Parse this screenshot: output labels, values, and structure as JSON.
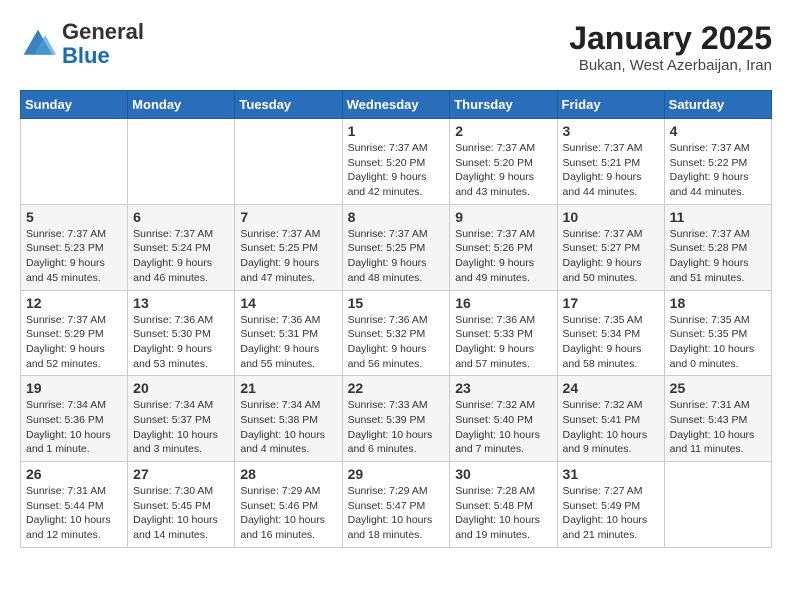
{
  "header": {
    "logo_line1": "General",
    "logo_line2": "Blue",
    "month": "January 2025",
    "location": "Bukan, West Azerbaijan, Iran"
  },
  "weekdays": [
    "Sunday",
    "Monday",
    "Tuesday",
    "Wednesday",
    "Thursday",
    "Friday",
    "Saturday"
  ],
  "weeks": [
    [
      {
        "day": "",
        "info": ""
      },
      {
        "day": "",
        "info": ""
      },
      {
        "day": "",
        "info": ""
      },
      {
        "day": "1",
        "info": "Sunrise: 7:37 AM\nSunset: 5:20 PM\nDaylight: 9 hours\nand 42 minutes."
      },
      {
        "day": "2",
        "info": "Sunrise: 7:37 AM\nSunset: 5:20 PM\nDaylight: 9 hours\nand 43 minutes."
      },
      {
        "day": "3",
        "info": "Sunrise: 7:37 AM\nSunset: 5:21 PM\nDaylight: 9 hours\nand 44 minutes."
      },
      {
        "day": "4",
        "info": "Sunrise: 7:37 AM\nSunset: 5:22 PM\nDaylight: 9 hours\nand 44 minutes."
      }
    ],
    [
      {
        "day": "5",
        "info": "Sunrise: 7:37 AM\nSunset: 5:23 PM\nDaylight: 9 hours\nand 45 minutes."
      },
      {
        "day": "6",
        "info": "Sunrise: 7:37 AM\nSunset: 5:24 PM\nDaylight: 9 hours\nand 46 minutes."
      },
      {
        "day": "7",
        "info": "Sunrise: 7:37 AM\nSunset: 5:25 PM\nDaylight: 9 hours\nand 47 minutes."
      },
      {
        "day": "8",
        "info": "Sunrise: 7:37 AM\nSunset: 5:25 PM\nDaylight: 9 hours\nand 48 minutes."
      },
      {
        "day": "9",
        "info": "Sunrise: 7:37 AM\nSunset: 5:26 PM\nDaylight: 9 hours\nand 49 minutes."
      },
      {
        "day": "10",
        "info": "Sunrise: 7:37 AM\nSunset: 5:27 PM\nDaylight: 9 hours\nand 50 minutes."
      },
      {
        "day": "11",
        "info": "Sunrise: 7:37 AM\nSunset: 5:28 PM\nDaylight: 9 hours\nand 51 minutes."
      }
    ],
    [
      {
        "day": "12",
        "info": "Sunrise: 7:37 AM\nSunset: 5:29 PM\nDaylight: 9 hours\nand 52 minutes."
      },
      {
        "day": "13",
        "info": "Sunrise: 7:36 AM\nSunset: 5:30 PM\nDaylight: 9 hours\nand 53 minutes."
      },
      {
        "day": "14",
        "info": "Sunrise: 7:36 AM\nSunset: 5:31 PM\nDaylight: 9 hours\nand 55 minutes."
      },
      {
        "day": "15",
        "info": "Sunrise: 7:36 AM\nSunset: 5:32 PM\nDaylight: 9 hours\nand 56 minutes."
      },
      {
        "day": "16",
        "info": "Sunrise: 7:36 AM\nSunset: 5:33 PM\nDaylight: 9 hours\nand 57 minutes."
      },
      {
        "day": "17",
        "info": "Sunrise: 7:35 AM\nSunset: 5:34 PM\nDaylight: 9 hours\nand 58 minutes."
      },
      {
        "day": "18",
        "info": "Sunrise: 7:35 AM\nSunset: 5:35 PM\nDaylight: 10 hours\nand 0 minutes."
      }
    ],
    [
      {
        "day": "19",
        "info": "Sunrise: 7:34 AM\nSunset: 5:36 PM\nDaylight: 10 hours\nand 1 minute."
      },
      {
        "day": "20",
        "info": "Sunrise: 7:34 AM\nSunset: 5:37 PM\nDaylight: 10 hours\nand 3 minutes."
      },
      {
        "day": "21",
        "info": "Sunrise: 7:34 AM\nSunset: 5:38 PM\nDaylight: 10 hours\nand 4 minutes."
      },
      {
        "day": "22",
        "info": "Sunrise: 7:33 AM\nSunset: 5:39 PM\nDaylight: 10 hours\nand 6 minutes."
      },
      {
        "day": "23",
        "info": "Sunrise: 7:32 AM\nSunset: 5:40 PM\nDaylight: 10 hours\nand 7 minutes."
      },
      {
        "day": "24",
        "info": "Sunrise: 7:32 AM\nSunset: 5:41 PM\nDaylight: 10 hours\nand 9 minutes."
      },
      {
        "day": "25",
        "info": "Sunrise: 7:31 AM\nSunset: 5:43 PM\nDaylight: 10 hours\nand 11 minutes."
      }
    ],
    [
      {
        "day": "26",
        "info": "Sunrise: 7:31 AM\nSunset: 5:44 PM\nDaylight: 10 hours\nand 12 minutes."
      },
      {
        "day": "27",
        "info": "Sunrise: 7:30 AM\nSunset: 5:45 PM\nDaylight: 10 hours\nand 14 minutes."
      },
      {
        "day": "28",
        "info": "Sunrise: 7:29 AM\nSunset: 5:46 PM\nDaylight: 10 hours\nand 16 minutes."
      },
      {
        "day": "29",
        "info": "Sunrise: 7:29 AM\nSunset: 5:47 PM\nDaylight: 10 hours\nand 18 minutes."
      },
      {
        "day": "30",
        "info": "Sunrise: 7:28 AM\nSunset: 5:48 PM\nDaylight: 10 hours\nand 19 minutes."
      },
      {
        "day": "31",
        "info": "Sunrise: 7:27 AM\nSunset: 5:49 PM\nDaylight: 10 hours\nand 21 minutes."
      },
      {
        "day": "",
        "info": ""
      }
    ]
  ]
}
